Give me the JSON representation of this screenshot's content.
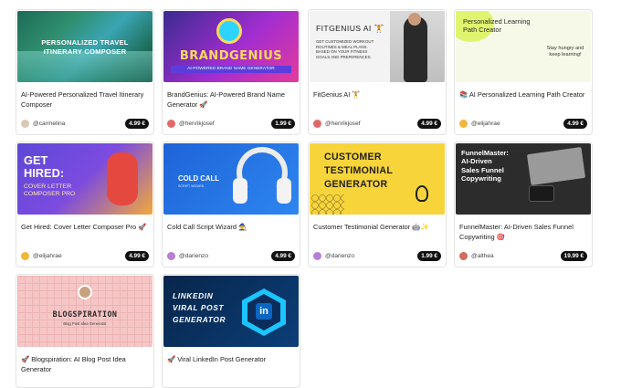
{
  "cards": [
    {
      "thumb_lines": [
        "PERSONALIZED TRAVEL",
        "ITINERARY COMPOSER"
      ],
      "title": "AI-Powered Personalized Travel Itinerary Composer",
      "user": "@carmelina",
      "price": "4.99 €",
      "avatar_color": "#d8c9b5"
    },
    {
      "thumb_logo": "BRANDGENIUS",
      "thumb_sub": "AI-POWERED BRAND NAME GENERATOR",
      "title": "BrandGenius: AI-Powered Brand Name Generator 🚀",
      "user": "@henrikjosef",
      "price": "1.99 €",
      "avatar_color": "#e06a6a"
    },
    {
      "thumb_head": "FITGENIUS AI 🏋",
      "thumb_body": "GET CUSTOMIZED WORKOUT ROUTINES & MEAL PLANS. BASED ON YOUR FITNESS GOALS AND PREFERENCES.",
      "title": "FitGenius AI 🏋",
      "user": "@henrikjosef",
      "price": "4.99 €",
      "avatar_color": "#e06a6a"
    },
    {
      "thumb_text": "Personalized Learning Path Creator",
      "thumb_side": "Stay hungry and keep learning!",
      "title": "📚 AI Personalized Learning Path Creator",
      "user": "@elijahrae",
      "price": "4.99 €",
      "avatar_color": "#f2b53a"
    },
    {
      "thumb_big": [
        "GET",
        "HIRED:"
      ],
      "thumb_small": [
        "COVER LETTER",
        "COMPOSER PRO"
      ],
      "title": "Get Hired: Cover Letter Composer Pro 🚀",
      "user": "@elijahrae",
      "price": "4.99 €",
      "avatar_color": "#f2b53a"
    },
    {
      "thumb_text": "COLD CALL",
      "thumb_sub": "SCRIPT WIZARD",
      "title": "Cold Call Script Wizard 🧙",
      "user": "@darienzo",
      "price": "4.99 €",
      "avatar_color": "#b77ed8"
    },
    {
      "thumb_lines": [
        "CUSTOMER",
        "TESTIMONIAL",
        "GENERATOR"
      ],
      "title": "Customer Testimonial Generator 🤖✨",
      "user": "@darienzo",
      "price": "1.99 €",
      "avatar_color": "#b77ed8"
    },
    {
      "thumb_lines": [
        "FunnelMaster:",
        "AI-Driven",
        "Sales Funnel",
        "Copywriting"
      ],
      "title": "FunnelMaster: AI-Driven Sales Funnel Copywriting 🎯",
      "user": "@althea",
      "price": "19.99 €",
      "avatar_color": "#d46a5b"
    },
    {
      "thumb_text": "BLOGSPIRATION",
      "thumb_sub": "Blog Post Idea Generator",
      "title": "🚀 Blogspiration: AI Blog Post Idea Generator",
      "user": "",
      "price": "",
      "avatar_color": ""
    },
    {
      "thumb_lines": [
        "LINKEDIN",
        "VIRAL POST",
        "GENERATOR"
      ],
      "thumb_logo": "in",
      "title": "🚀 Viral LinkedIn Post Generator",
      "user": "",
      "price": "",
      "avatar_color": ""
    }
  ]
}
